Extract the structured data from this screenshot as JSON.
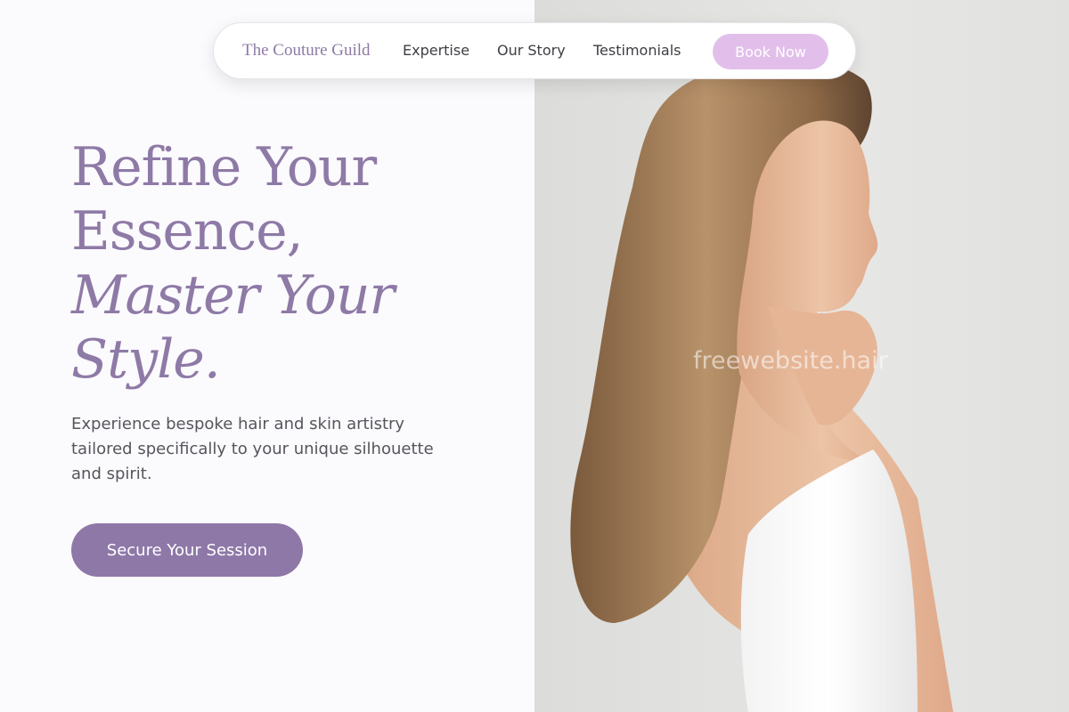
{
  "nav": {
    "brand": "The Couture Guild",
    "links": [
      {
        "label": "Expertise"
      },
      {
        "label": "Our Story"
      },
      {
        "label": "Testimonials"
      }
    ],
    "book_label": "Book Now"
  },
  "hero": {
    "headline_lines": [
      "Refine Your",
      "Essence,",
      "Master Your",
      "Style."
    ],
    "subtext": "Experience bespoke hair and skin artistry tailored specifically to your unique silhouette and spirit.",
    "cta_label": "Secure Your Session"
  },
  "image": {
    "watermark": "freewebsite.hair"
  },
  "colors": {
    "accent": "#8e7aa6",
    "button_primary": "#8e78a8",
    "button_book": "#e2bfea",
    "background": "#fbfafd",
    "photo_background": "#e3e3e1"
  }
}
